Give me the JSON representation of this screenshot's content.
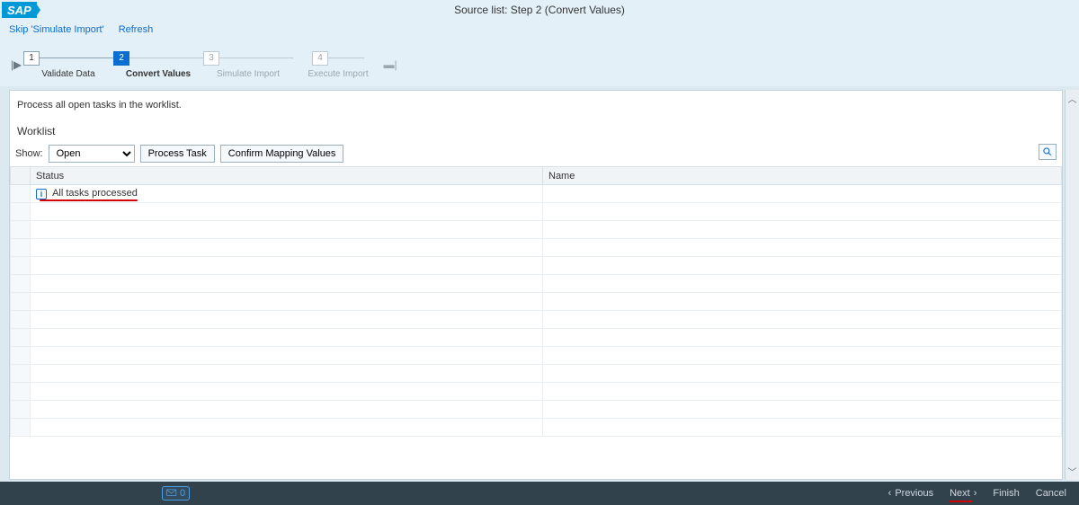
{
  "header": {
    "title": "Source list: Step 2  (Convert Values)"
  },
  "toolbar": {
    "skip": "Skip 'Simulate Import'",
    "refresh": "Refresh"
  },
  "wizard": {
    "steps": [
      {
        "num": "1",
        "label": "Validate Data"
      },
      {
        "num": "2",
        "label": "Convert Values"
      },
      {
        "num": "3",
        "label": "Simulate Import"
      },
      {
        "num": "4",
        "label": "Execute Import"
      }
    ]
  },
  "content": {
    "instruction": "Process all open tasks in the worklist.",
    "section": "Worklist",
    "show_label": "Show:",
    "show_value": "Open",
    "btn_process": "Process Task",
    "btn_confirm": "Confirm Mapping Values"
  },
  "table": {
    "col_status": "Status",
    "col_name": "Name",
    "row0_status": "All tasks processed"
  },
  "footer": {
    "msg_count": "0",
    "prev": "Previous",
    "next": "Next",
    "finish": "Finish",
    "cancel": "Cancel"
  }
}
